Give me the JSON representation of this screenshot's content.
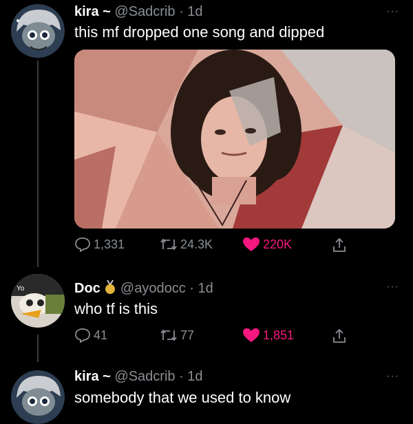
{
  "tweets": [
    {
      "name": "kira",
      "name_suffix": "~",
      "handle": "@Sadcrib",
      "time": "· 1d",
      "text": "this mf dropped one song and dipped",
      "replies": "1,331",
      "retweets": "24.3K",
      "likes": "220K",
      "liked": true
    },
    {
      "name": "Doc",
      "badge_icon": "medal-icon",
      "handle": "@ayodocc",
      "time": "· 1d",
      "text": "who tf is this",
      "replies": "41",
      "retweets": "77",
      "likes": "1,851",
      "liked": true
    },
    {
      "name": "kira",
      "name_suffix": "~",
      "handle": "@Sadcrib",
      "time": "· 1d",
      "text": "somebody that we used to know"
    }
  ],
  "more_label": "···",
  "colors": {
    "like": "#f91880",
    "muted": "#8a8f94",
    "background": "#000000"
  }
}
